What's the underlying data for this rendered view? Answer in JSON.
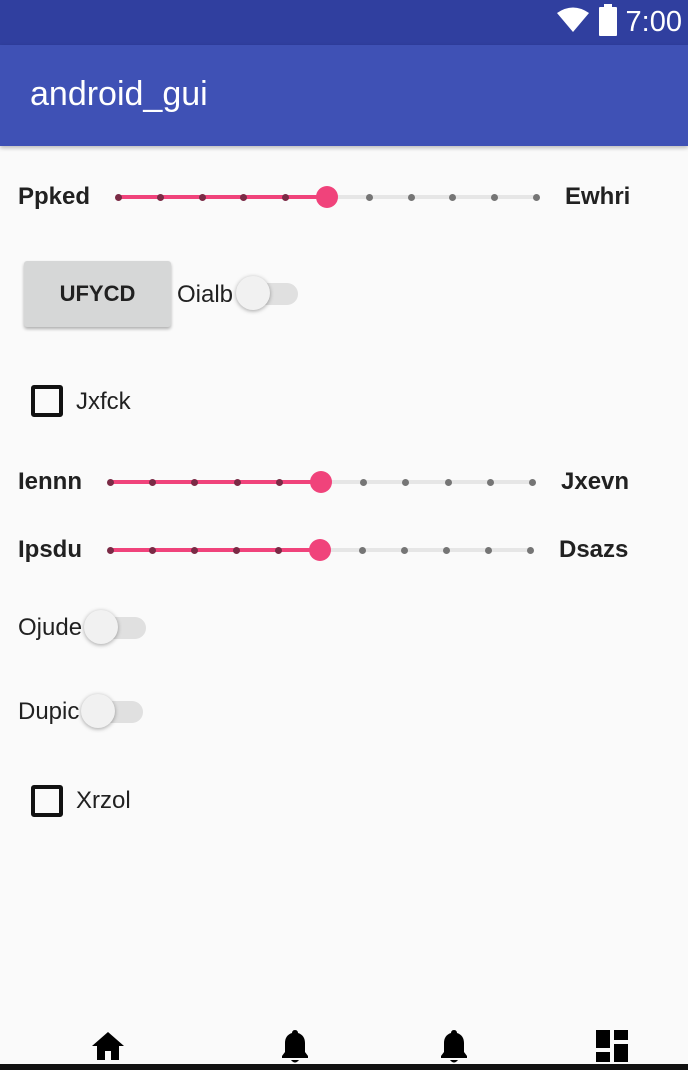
{
  "status_bar": {
    "time": "7:00",
    "icons": [
      "wifi-icon",
      "battery-icon"
    ]
  },
  "app_bar": {
    "title": "android_gui"
  },
  "slider_1": {
    "left_label": "Ppked",
    "right_label": "Ewhri",
    "value": 5,
    "max": 10
  },
  "button": {
    "label": "UFYCD"
  },
  "switch_1": {
    "label": "Oialb",
    "checked": false
  },
  "checkbox_1": {
    "label": "Jxfck",
    "checked": false
  },
  "slider_2": {
    "left_label": "Iennn",
    "right_label": "Jxevn",
    "value": 5,
    "max": 10
  },
  "slider_3": {
    "left_label": "Ipsdu",
    "right_label": "Dsazs",
    "value": 5,
    "max": 10
  },
  "switch_2": {
    "label": "Ojude",
    "checked": false
  },
  "switch_3": {
    "label": "Dupic",
    "checked": false
  },
  "checkbox_2": {
    "label": "Xrzol",
    "checked": false
  },
  "bottom_nav": {
    "icons": [
      "home-icon",
      "bell-icon",
      "bell-icon",
      "dashboard-icon"
    ]
  },
  "colors": {
    "status_bar": "#303f9f",
    "app_bar": "#3f51b5",
    "accent": "#f0437b",
    "background": "#fafafa"
  }
}
